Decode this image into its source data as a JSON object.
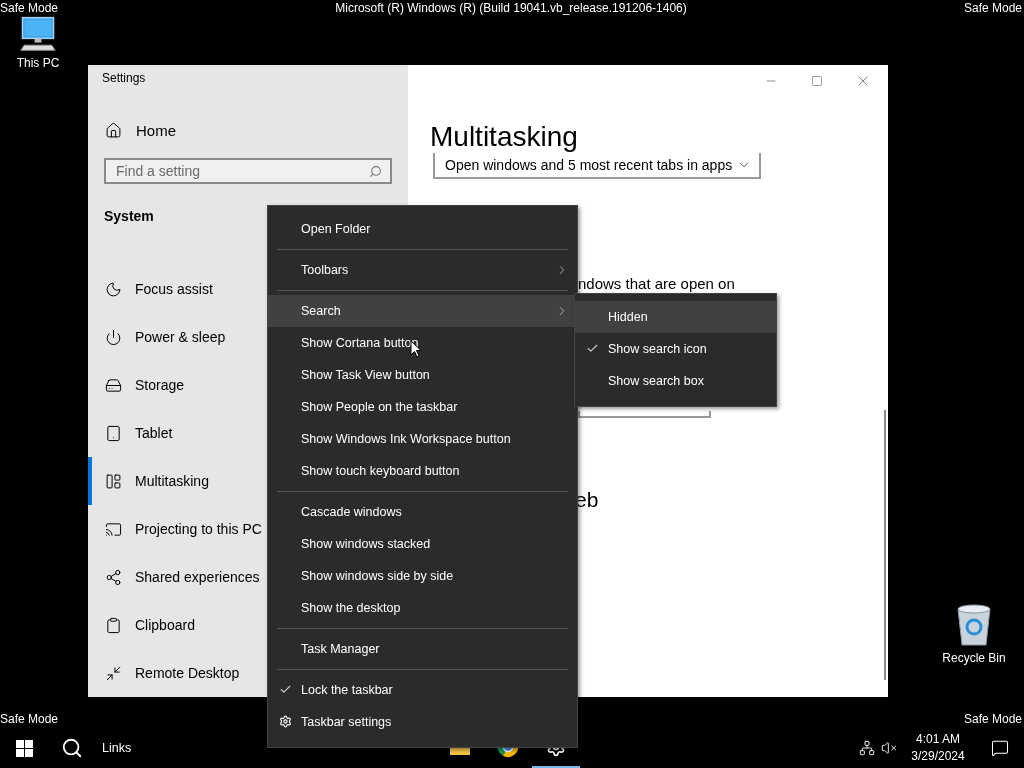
{
  "safe_mode_labels": [
    "Safe Mode",
    "Safe Mode",
    "Safe Mode",
    "Safe Mode"
  ],
  "build_info": "Microsoft (R) Windows (R) (Build 19041.vb_release.191206-1406)",
  "desktop_icons": [
    {
      "kind": "computer",
      "label": "This PC"
    },
    {
      "kind": "recycle-bin",
      "label": "Recycle Bin"
    }
  ],
  "settings_window": {
    "title": "Settings",
    "home": "Home",
    "search": {
      "placeholder": "Find a setting"
    },
    "section": "System",
    "nav_items": [
      {
        "label": "Focus assist",
        "selected": false
      },
      {
        "label": "Power & sleep",
        "selected": false
      },
      {
        "label": "Storage",
        "selected": false
      },
      {
        "label": "Tablet",
        "selected": false
      },
      {
        "label": "Multitasking",
        "selected": true
      },
      {
        "label": "Projecting to this PC",
        "selected": false
      },
      {
        "label": "Shared experiences",
        "selected": false
      },
      {
        "label": "Clipboard",
        "selected": false
      },
      {
        "label": "Remote Desktop",
        "selected": false
      }
    ],
    "page_title": "Multitasking",
    "dropdown_value": "Open windows and 5 most recent tabs in apps",
    "partial_text": "ndows that are open on",
    "partial_heading": "eb"
  },
  "context_menu": {
    "items": [
      {
        "kind": "item",
        "label": "Open Folder",
        "highlighted": false,
        "checked": false,
        "submenu": false
      },
      {
        "kind": "separator"
      },
      {
        "kind": "item",
        "label": "Toolbars",
        "highlighted": false,
        "checked": false,
        "submenu": true
      },
      {
        "kind": "separator"
      },
      {
        "kind": "item",
        "label": "Search",
        "highlighted": true,
        "checked": false,
        "submenu": true
      },
      {
        "kind": "item",
        "label": "Show Cortana button",
        "highlighted": false,
        "checked": false,
        "submenu": false
      },
      {
        "kind": "item",
        "label": "Show Task View button",
        "highlighted": false,
        "checked": false,
        "submenu": false
      },
      {
        "kind": "item",
        "label": "Show People on the taskbar",
        "highlighted": false,
        "checked": false,
        "submenu": false
      },
      {
        "kind": "item",
        "label": "Show Windows Ink Workspace button",
        "highlighted": false,
        "checked": false,
        "submenu": false
      },
      {
        "kind": "item",
        "label": "Show touch keyboard button",
        "highlighted": false,
        "checked": false,
        "submenu": false
      },
      {
        "kind": "separator"
      },
      {
        "kind": "item",
        "label": "Cascade windows",
        "highlighted": false,
        "checked": false,
        "submenu": false
      },
      {
        "kind": "item",
        "label": "Show windows stacked",
        "highlighted": false,
        "checked": false,
        "submenu": false
      },
      {
        "kind": "item",
        "label": "Show windows side by side",
        "highlighted": false,
        "checked": false,
        "submenu": false
      },
      {
        "kind": "item",
        "label": "Show the desktop",
        "highlighted": false,
        "checked": false,
        "submenu": false
      },
      {
        "kind": "separator"
      },
      {
        "kind": "item",
        "label": "Task Manager",
        "highlighted": false,
        "checked": false,
        "submenu": false
      },
      {
        "kind": "separator"
      },
      {
        "kind": "item",
        "label": "Lock the taskbar",
        "highlighted": false,
        "checked": true,
        "submenu": false
      },
      {
        "kind": "settings-item",
        "label": "Taskbar settings",
        "highlighted": false,
        "checked": false,
        "submenu": false
      }
    ]
  },
  "search_submenu": {
    "items": [
      {
        "label": "Hidden",
        "highlighted": true,
        "checked": false
      },
      {
        "label": "Show search icon",
        "highlighted": false,
        "checked": true
      },
      {
        "label": "Show search box",
        "highlighted": false,
        "checked": false
      }
    ]
  },
  "taskbar": {
    "toolbar_label": "Links",
    "apps": [
      {
        "kind": "folder",
        "active": false
      },
      {
        "kind": "browser",
        "active": false
      },
      {
        "kind": "gear",
        "active": true
      }
    ],
    "time": "4:01 AM",
    "date": "3/29/2024"
  }
}
